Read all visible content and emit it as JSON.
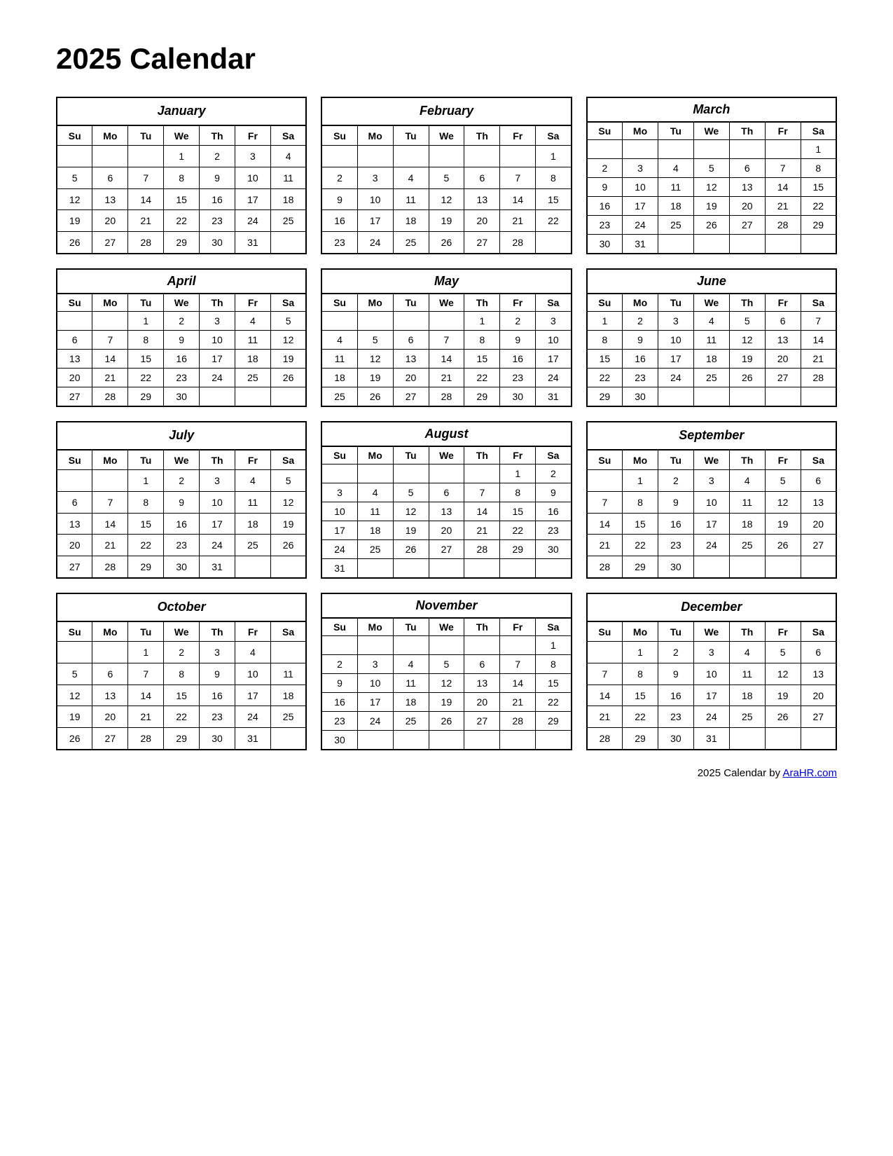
{
  "title": "2025 Calendar",
  "footer": {
    "text": "2025  Calendar by ",
    "link_text": "AraHR.com",
    "link_url": "AraHR.com"
  },
  "months": [
    {
      "name": "January",
      "weeks": [
        [
          "",
          "",
          "",
          "1",
          "2",
          "3",
          "4"
        ],
        [
          "5",
          "6",
          "7",
          "8",
          "9",
          "10",
          "11"
        ],
        [
          "12",
          "13",
          "14",
          "15",
          "16",
          "17",
          "18"
        ],
        [
          "19",
          "20",
          "21",
          "22",
          "23",
          "24",
          "25"
        ],
        [
          "26",
          "27",
          "28",
          "29",
          "30",
          "31",
          ""
        ]
      ]
    },
    {
      "name": "February",
      "weeks": [
        [
          "",
          "",
          "",
          "",
          "",
          "",
          "1"
        ],
        [
          "2",
          "3",
          "4",
          "5",
          "6",
          "7",
          "8"
        ],
        [
          "9",
          "10",
          "11",
          "12",
          "13",
          "14",
          "15"
        ],
        [
          "16",
          "17",
          "18",
          "19",
          "20",
          "21",
          "22"
        ],
        [
          "23",
          "24",
          "25",
          "26",
          "27",
          "28",
          ""
        ]
      ]
    },
    {
      "name": "March",
      "weeks": [
        [
          "",
          "",
          "",
          "",
          "",
          "",
          "1"
        ],
        [
          "2",
          "3",
          "4",
          "5",
          "6",
          "7",
          "8"
        ],
        [
          "9",
          "10",
          "11",
          "12",
          "13",
          "14",
          "15"
        ],
        [
          "16",
          "17",
          "18",
          "19",
          "20",
          "21",
          "22"
        ],
        [
          "23",
          "24",
          "25",
          "26",
          "27",
          "28",
          "29"
        ],
        [
          "30",
          "31",
          "",
          "",
          "",
          "",
          ""
        ]
      ]
    },
    {
      "name": "April",
      "weeks": [
        [
          "",
          "",
          "1",
          "2",
          "3",
          "4",
          "5"
        ],
        [
          "6",
          "7",
          "8",
          "9",
          "10",
          "11",
          "12"
        ],
        [
          "13",
          "14",
          "15",
          "16",
          "17",
          "18",
          "19"
        ],
        [
          "20",
          "21",
          "22",
          "23",
          "24",
          "25",
          "26"
        ],
        [
          "27",
          "28",
          "29",
          "30",
          "",
          "",
          ""
        ]
      ]
    },
    {
      "name": "May",
      "weeks": [
        [
          "",
          "",
          "",
          "",
          "1",
          "2",
          "3"
        ],
        [
          "4",
          "5",
          "6",
          "7",
          "8",
          "9",
          "10"
        ],
        [
          "11",
          "12",
          "13",
          "14",
          "15",
          "16",
          "17"
        ],
        [
          "18",
          "19",
          "20",
          "21",
          "22",
          "23",
          "24"
        ],
        [
          "25",
          "26",
          "27",
          "28",
          "29",
          "30",
          "31"
        ]
      ]
    },
    {
      "name": "June",
      "weeks": [
        [
          "1",
          "2",
          "3",
          "4",
          "5",
          "6",
          "7"
        ],
        [
          "8",
          "9",
          "10",
          "11",
          "12",
          "13",
          "14"
        ],
        [
          "15",
          "16",
          "17",
          "18",
          "19",
          "20",
          "21"
        ],
        [
          "22",
          "23",
          "24",
          "25",
          "26",
          "27",
          "28"
        ],
        [
          "29",
          "30",
          "",
          "",
          "",
          "",
          ""
        ]
      ]
    },
    {
      "name": "July",
      "weeks": [
        [
          "",
          "",
          "1",
          "2",
          "3",
          "4",
          "5"
        ],
        [
          "6",
          "7",
          "8",
          "9",
          "10",
          "11",
          "12"
        ],
        [
          "13",
          "14",
          "15",
          "16",
          "17",
          "18",
          "19"
        ],
        [
          "20",
          "21",
          "22",
          "23",
          "24",
          "25",
          "26"
        ],
        [
          "27",
          "28",
          "29",
          "30",
          "31",
          "",
          ""
        ]
      ]
    },
    {
      "name": "August",
      "weeks": [
        [
          "",
          "",
          "",
          "",
          "",
          "1",
          "2"
        ],
        [
          "3",
          "4",
          "5",
          "6",
          "7",
          "8",
          "9"
        ],
        [
          "10",
          "11",
          "12",
          "13",
          "14",
          "15",
          "16"
        ],
        [
          "17",
          "18",
          "19",
          "20",
          "21",
          "22",
          "23"
        ],
        [
          "24",
          "25",
          "26",
          "27",
          "28",
          "29",
          "30"
        ],
        [
          "31",
          "",
          "",
          "",
          "",
          "",
          ""
        ]
      ]
    },
    {
      "name": "September",
      "weeks": [
        [
          "",
          "1",
          "2",
          "3",
          "4",
          "5",
          "6"
        ],
        [
          "7",
          "8",
          "9",
          "10",
          "11",
          "12",
          "13"
        ],
        [
          "14",
          "15",
          "16",
          "17",
          "18",
          "19",
          "20"
        ],
        [
          "21",
          "22",
          "23",
          "24",
          "25",
          "26",
          "27"
        ],
        [
          "28",
          "29",
          "30",
          "",
          "",
          "",
          ""
        ]
      ]
    },
    {
      "name": "October",
      "weeks": [
        [
          "",
          "",
          "1",
          "2",
          "3",
          "4",
          ""
        ],
        [
          "5",
          "6",
          "7",
          "8",
          "9",
          "10",
          "11"
        ],
        [
          "12",
          "13",
          "14",
          "15",
          "16",
          "17",
          "18"
        ],
        [
          "19",
          "20",
          "21",
          "22",
          "23",
          "24",
          "25"
        ],
        [
          "26",
          "27",
          "28",
          "29",
          "30",
          "31",
          ""
        ]
      ]
    },
    {
      "name": "November",
      "weeks": [
        [
          "",
          "",
          "",
          "",
          "",
          "",
          "1"
        ],
        [
          "2",
          "3",
          "4",
          "5",
          "6",
          "7",
          "8"
        ],
        [
          "9",
          "10",
          "11",
          "12",
          "13",
          "14",
          "15"
        ],
        [
          "16",
          "17",
          "18",
          "19",
          "20",
          "21",
          "22"
        ],
        [
          "23",
          "24",
          "25",
          "26",
          "27",
          "28",
          "29"
        ],
        [
          "30",
          "",
          "",
          "",
          "",
          "",
          ""
        ]
      ]
    },
    {
      "name": "December",
      "weeks": [
        [
          "",
          "1",
          "2",
          "3",
          "4",
          "5",
          "6"
        ],
        [
          "7",
          "8",
          "9",
          "10",
          "11",
          "12",
          "13"
        ],
        [
          "14",
          "15",
          "16",
          "17",
          "18",
          "19",
          "20"
        ],
        [
          "21",
          "22",
          "23",
          "24",
          "25",
          "26",
          "27"
        ],
        [
          "28",
          "29",
          "30",
          "31",
          "",
          "",
          ""
        ]
      ]
    }
  ],
  "day_headers": [
    "Su",
    "Mo",
    "Tu",
    "We",
    "Th",
    "Fr",
    "Sa"
  ]
}
